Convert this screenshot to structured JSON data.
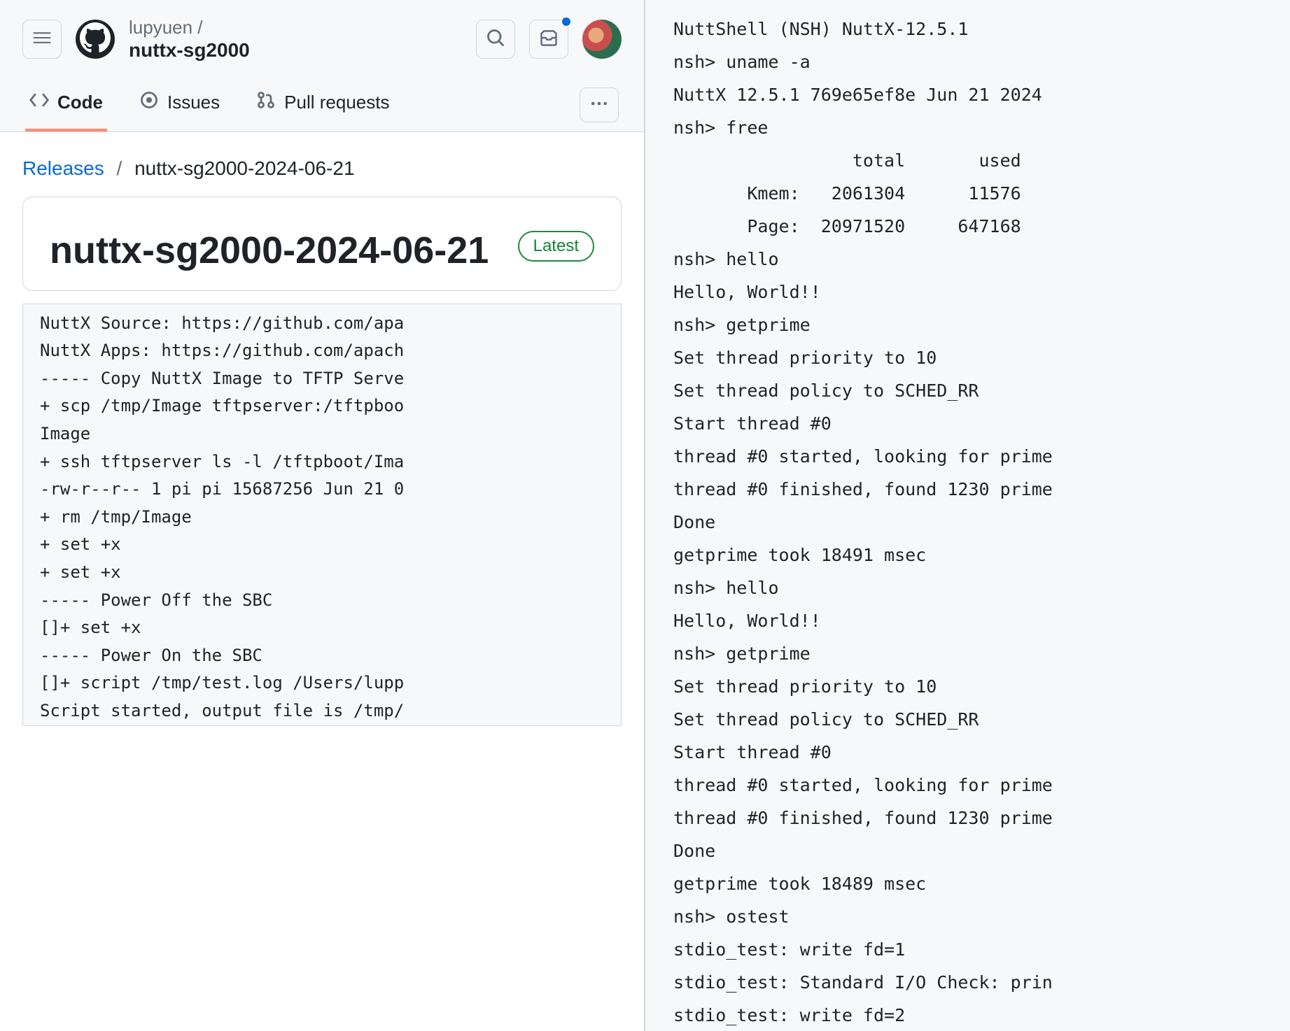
{
  "header": {
    "owner": "lupyuen /",
    "repo": "nuttx-sg2000"
  },
  "tabs": {
    "code": "Code",
    "issues": "Issues",
    "pulls": "Pull requests"
  },
  "breadcrumb": {
    "releases": "Releases",
    "sep": "/",
    "current": "nuttx-sg2000-2024-06-21"
  },
  "release": {
    "title": "nuttx-sg2000-2024-06-21",
    "badge": "Latest"
  },
  "codeblock": "NuttX Source: https://github.com/apa\nNuttX Apps: https://github.com/apach\n----- Copy NuttX Image to TFTP Serve\n+ scp /tmp/Image tftpserver:/tftpboo\nImage\n+ ssh tftpserver ls -l /tftpboot/Ima\n-rw-r--r-- 1 pi pi 15687256 Jun 21 0\n+ rm /tmp/Image\n+ set +x\n+ set +x\n----- Power Off the SBC\n[]+ set +x\n----- Power On the SBC\n[]+ script /tmp/test.log /Users/lupp\nScript started, output file is /tmp/",
  "terminal": "NuttShell (NSH) NuttX-12.5.1\nnsh> uname -a\nNuttX 12.5.1 769e65ef8e Jun 21 2024\nnsh> free\n                 total       used\n       Kmem:   2061304      11576\n       Page:  20971520     647168\nnsh> hello\nHello, World!!\nnsh> getprime\nSet thread priority to 10\nSet thread policy to SCHED_RR\nStart thread #0\nthread #0 started, looking for prime\nthread #0 finished, found 1230 prime\nDone\ngetprime took 18491 msec\nnsh> hello\nHello, World!!\nnsh> getprime\nSet thread priority to 10\nSet thread policy to SCHED_RR\nStart thread #0\nthread #0 started, looking for prime\nthread #0 finished, found 1230 prime\nDone\ngetprime took 18489 msec\nnsh> ostest\nstdio_test: write fd=1\nstdio_test: Standard I/O Check: prin\nstdio_test: write fd=2"
}
